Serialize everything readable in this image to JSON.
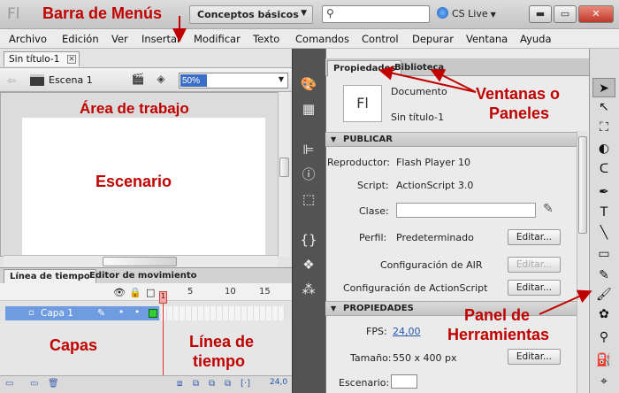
{
  "window": {
    "logo": "Fl",
    "workspace": "Conceptos básicos",
    "search_placeholder": "",
    "cs_live": "CS Live",
    "minimize": "▬",
    "maximize": "▭",
    "close": "✕"
  },
  "menu": [
    "Archivo",
    "Edición",
    "Ver",
    "Insertar",
    "Modificar",
    "Texto",
    "Comandos",
    "Control",
    "Depurar",
    "Ventana",
    "Ayuda"
  ],
  "document": {
    "tab": "Sin título-1",
    "scene": "Escena 1",
    "zoom": "50%"
  },
  "timeline": {
    "tabs": [
      "Línea de tiempo",
      "Editor de movimiento"
    ],
    "frame_numbers": [
      "1",
      "5",
      "10",
      "15"
    ],
    "playhead": "1",
    "layer": "Capa 1",
    "fps": "24,0"
  },
  "properties": {
    "tabs": [
      "Propiedades",
      "Biblioteca"
    ],
    "doc_icon": "Fl",
    "doc_type": "Documento",
    "doc_name": "Sin título-1",
    "publish": {
      "header": "PUBLICAR",
      "player_label": "Reproductor:",
      "player": "Flash Player 10",
      "script_label": "Script:",
      "script": "ActionScript 3.0",
      "class_label": "Clase:",
      "profile_label": "Perfil:",
      "profile": "Predeterminado",
      "edit": "Editar...",
      "air_label": "Configuración de AIR",
      "as_label": "Configuración de ActionScript"
    },
    "props": {
      "header": "PROPIEDADES",
      "fps_label": "FPS:",
      "fps": "24,00",
      "size_label": "Tamaño:",
      "size": "550 x 400 px",
      "stage_label": "Escenario:",
      "edit": "Editar..."
    }
  },
  "annotations": {
    "menu_bar": "Barra de Menús",
    "work_area": "Área de trabajo",
    "stage": "Escenario",
    "panels_1": "Ventanas o",
    "panels_2": "Paneles",
    "tools_1": "Panel de",
    "tools_2": "Herramientas",
    "layers": "Capas",
    "timeline_1": "Línea de",
    "timeline_2": "tiempo"
  },
  "colors": {
    "annotation": "#c00000",
    "layer_highlight": "#6f9be0",
    "stage": "#ffffff"
  }
}
